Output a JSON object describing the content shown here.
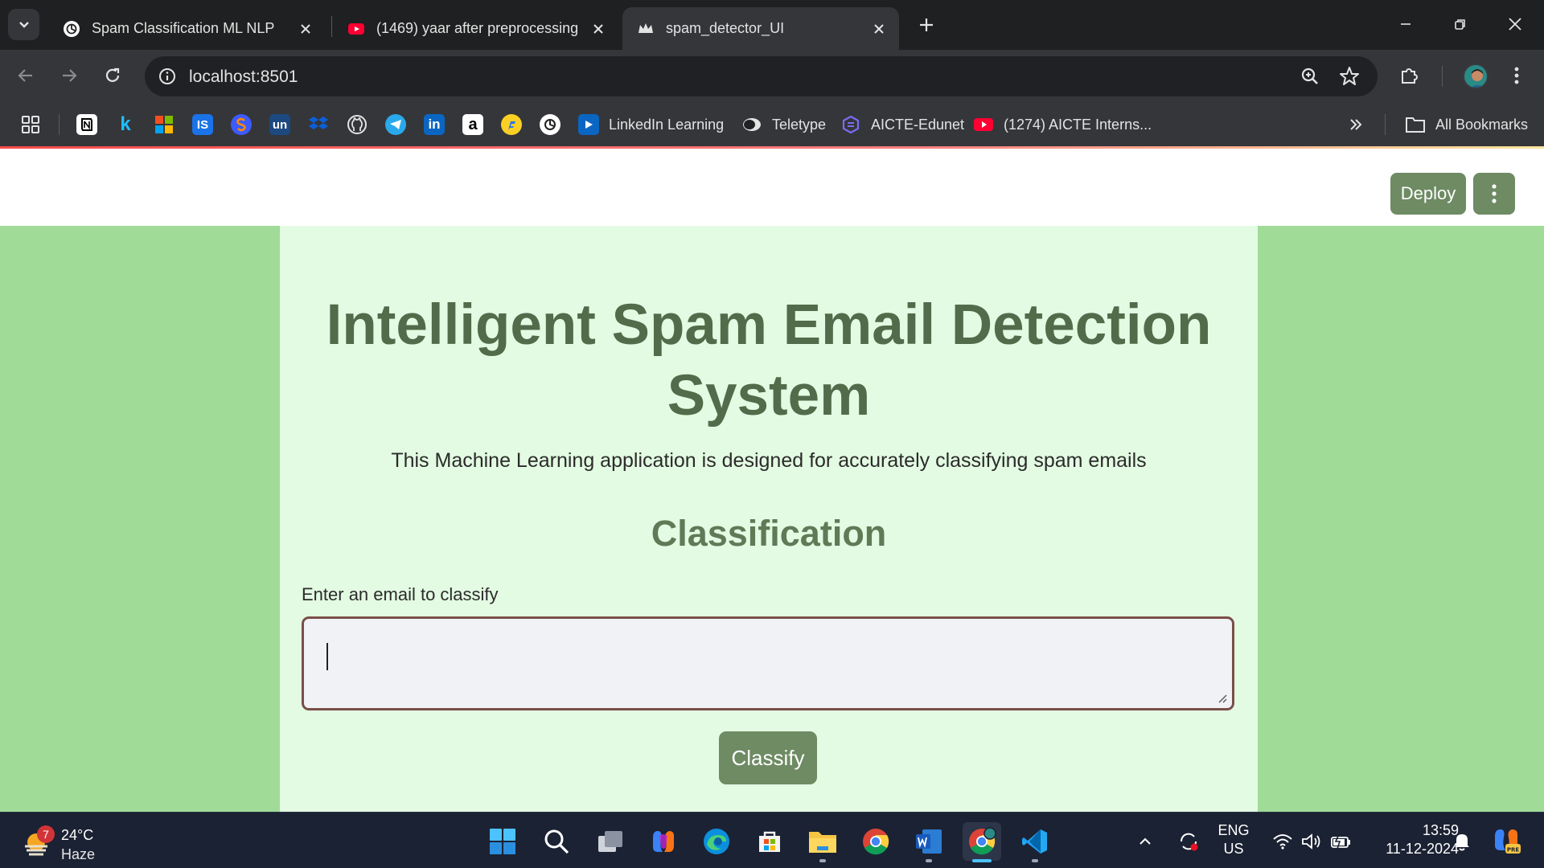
{
  "browser": {
    "tabs": [
      {
        "title": "Spam Classification ML NLP",
        "favicon": "chatgpt-icon",
        "active": false
      },
      {
        "title": "(1469) yaar after preprocessing",
        "favicon": "youtube-icon",
        "active": false
      },
      {
        "title": "spam_detector_UI",
        "favicon": "streamlit-crown-icon",
        "active": true
      }
    ],
    "url": "localhost:8501",
    "bookmarks": [
      {
        "label": "LinkedIn Learning",
        "icon": "linkedin-learning-icon"
      },
      {
        "label": "Teletype",
        "icon": "teletype-icon"
      },
      {
        "label": "AICTE-Edunet",
        "icon": "edunet-icon"
      },
      {
        "label": "(1274) AICTE Interns...",
        "icon": "youtube-icon"
      }
    ],
    "bookmark_icon_glyphs": {
      "kaggle": "k",
      "interviewbit": "IS",
      "unstop": "un",
      "linkedin": "in",
      "amazon": "a"
    },
    "all_bookmarks_label": "All Bookmarks"
  },
  "app": {
    "deploy_label": "Deploy",
    "title": "Intelligent Spam Email Detection System",
    "subtitle": "This Machine Learning application is designed for accurately classifying spam emails",
    "section_title": "Classification",
    "input_label": "Enter an email to classify",
    "input_value": "",
    "classify_label": "Classify",
    "colors": {
      "background": "#a0dc98",
      "main_column": "#e3fbe2",
      "title": "#526b4a",
      "button": "#6e8b63",
      "input_border": "#7a4f48"
    }
  },
  "taskbar": {
    "weather_temp": "24°C",
    "weather_condition": "Haze",
    "weather_badge": "7",
    "language_line1": "ENG",
    "language_line2": "US",
    "time": "13:59",
    "date": "11-12-2024"
  }
}
